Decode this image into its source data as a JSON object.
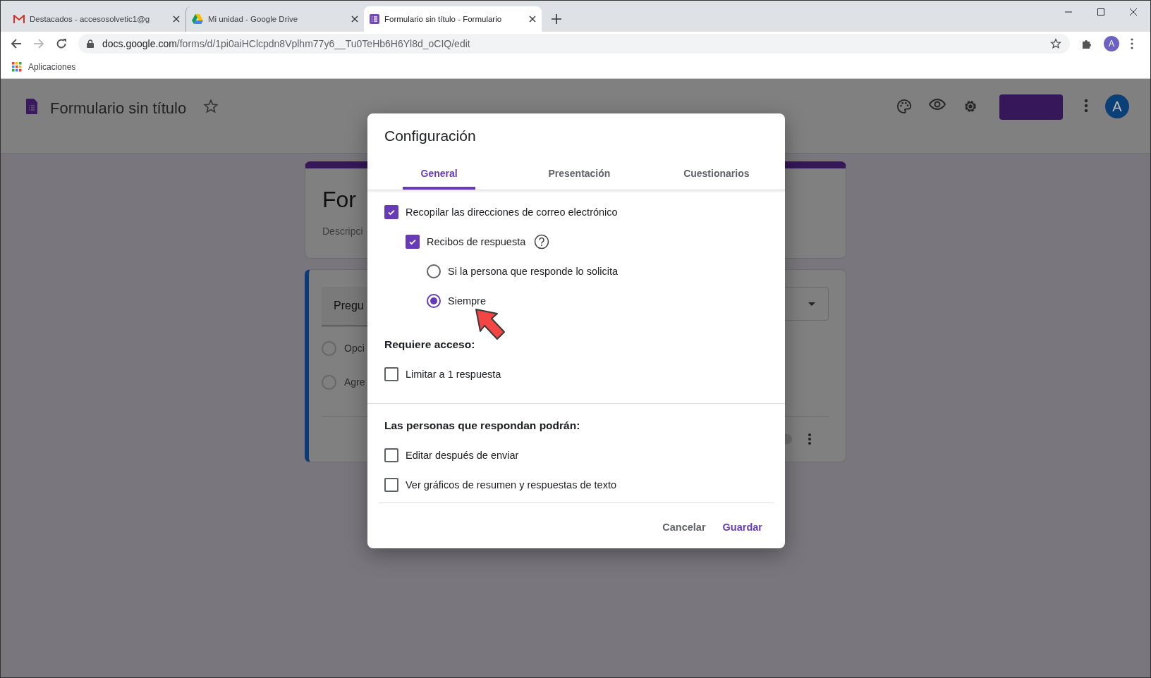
{
  "browser": {
    "tabs": [
      {
        "title": "Destacados - accesosolvetic1@g",
        "selected": false
      },
      {
        "title": "Mi unidad - Google Drive",
        "selected": false
      },
      {
        "title": "Formulario sin título - Formulario",
        "selected": true
      }
    ],
    "url_host": "docs.google.com",
    "url_path": "/forms/d/1pi0aiHClcpdn8Vplhm77y6__Tu0TeHb6H6Yl8d_oCIQ/edit",
    "profile_initial": "A",
    "bookmarks": [
      "Aplicaciones"
    ]
  },
  "forms_header": {
    "title": "Formulario sin título",
    "avatar_initial": "A"
  },
  "form_behind": {
    "title_fragment": "For",
    "description_fragment": "Descripci",
    "question_fragment": "Pregu",
    "options": [
      {
        "label": "Opci",
        "selected": false
      },
      {
        "label": "Agre",
        "selected": false
      }
    ],
    "required_on": false
  },
  "dialog": {
    "title": "Configuración",
    "tabs": [
      {
        "label": "General",
        "selected": true
      },
      {
        "label": "Presentación",
        "selected": false
      },
      {
        "label": "Cuestionarios",
        "selected": false
      }
    ],
    "sections": [
      {
        "items": [
          {
            "kind": "checkbox",
            "label": "Recopilar las direcciones de correo electrónico",
            "checked": true,
            "children": [
              {
                "kind": "checkbox",
                "label": "Recibos de respuesta",
                "checked": true,
                "help": true,
                "children": [
                  {
                    "kind": "radio",
                    "label": "Si la persona que responde lo solicita",
                    "selected": false
                  },
                  {
                    "kind": "radio",
                    "label": "Siempre",
                    "selected": true
                  }
                ]
              }
            ]
          }
        ]
      },
      {
        "heading": "Requiere acceso:",
        "items": [
          {
            "kind": "checkbox",
            "label": "Limitar a 1 respuesta",
            "checked": false
          }
        ]
      },
      {
        "heading": "Las personas que respondan podrán:",
        "items": [
          {
            "kind": "checkbox",
            "label": "Editar después de enviar",
            "checked": false
          },
          {
            "kind": "checkbox",
            "label": "Ver gráficos de resumen y respuestas de texto",
            "checked": false
          }
        ]
      }
    ],
    "buttons": [
      {
        "label": "Cancelar",
        "kind": "secondary"
      },
      {
        "label": "Guardar",
        "kind": "primary"
      }
    ]
  }
}
